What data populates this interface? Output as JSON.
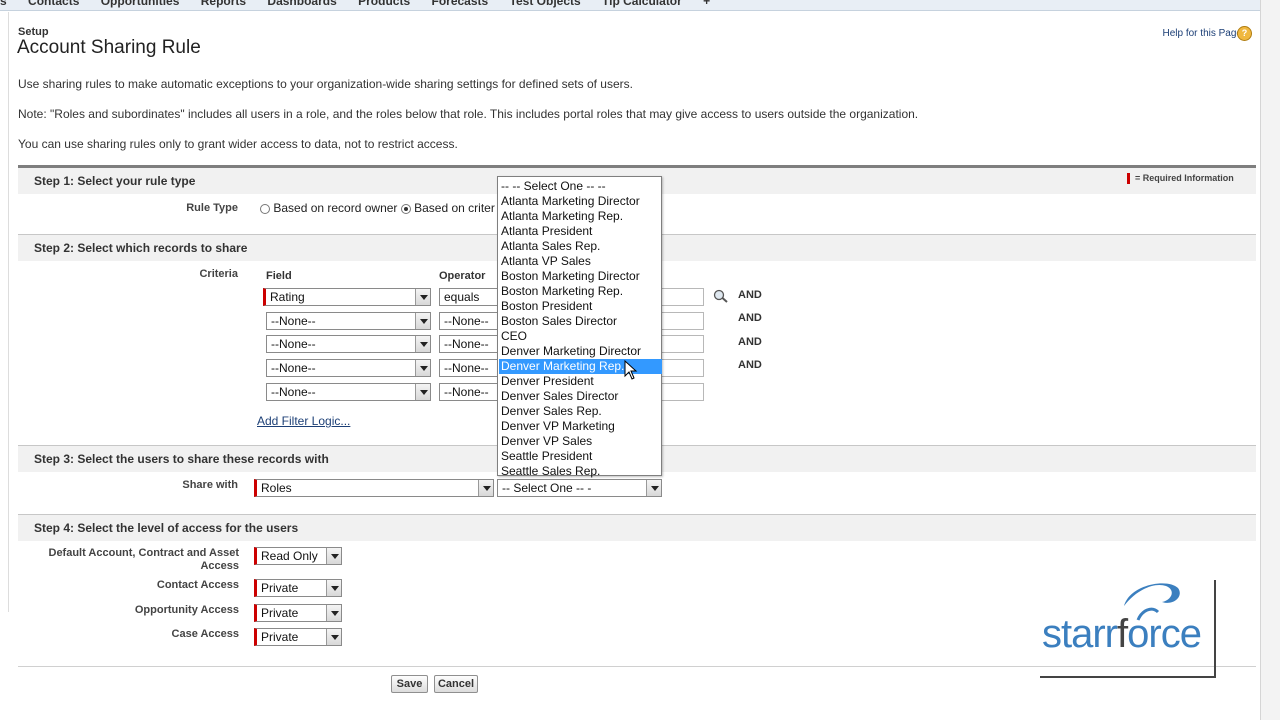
{
  "top_nav": {
    "tabs": [
      "s",
      "Contacts",
      "Opportunities",
      "Reports",
      "Dashboards",
      "Products",
      "Forecasts",
      "Test Objects",
      "Tip Calculator",
      "+"
    ]
  },
  "header": {
    "breadcrumb": "Setup",
    "title": "Account Sharing Rule",
    "help_link": "Help for this Page",
    "help_icon": "help-icon"
  },
  "intro": [
    "Use sharing rules to make automatic exceptions to your organization-wide sharing settings for defined sets of users.",
    "Note: \"Roles and subordinates\" includes all users in a role, and the roles below that role. This includes portal roles that may give access to users outside the organization.",
    "You can use sharing rules only to grant wider access to data, not to restrict access."
  ],
  "required_info": "= Required Information",
  "step1": {
    "title": "Step 1: Select your rule type",
    "rule_type_label": "Rule Type",
    "option_owner": "Based on record owner",
    "option_criteria": "Based on criter",
    "selected": "criteria"
  },
  "step2": {
    "title": "Step 2: Select which records to share",
    "criteria_label": "Criteria",
    "field_header": "Field",
    "operator_header": "Operator",
    "rows": [
      {
        "field": "Rating",
        "operator": "equals",
        "and": "AND"
      },
      {
        "field": "--None--",
        "operator": "--None--",
        "and": "AND"
      },
      {
        "field": "--None--",
        "operator": "--None--",
        "and": "AND"
      },
      {
        "field": "--None--",
        "operator": "--None--",
        "and": "AND"
      },
      {
        "field": "--None--",
        "operator": "--None--",
        "and": ""
      }
    ],
    "add_filter_logic": "Add Filter Logic..."
  },
  "step3": {
    "title": "Step 3: Select the users to share these records with",
    "share_with_label": "Share with",
    "share_with_value": "Roles",
    "role_select_value": "-- Select One -- -",
    "dropdown_options": [
      "-- -- Select One -- --",
      "Atlanta Marketing Director",
      "Atlanta Marketing Rep.",
      "Atlanta President",
      "Atlanta Sales Rep.",
      "Atlanta VP Sales",
      "Boston Marketing Director",
      "Boston Marketing Rep.",
      "Boston President",
      "Boston Sales Director",
      "CEO",
      "Denver Marketing Director",
      "Denver Marketing Rep.",
      "Denver President",
      "Denver Sales Director",
      "Denver Sales Rep.",
      "Denver VP Marketing",
      "Denver VP Sales",
      "Seattle President",
      "Seattle Sales Rep."
    ],
    "highlighted_option": "Denver Marketing Rep."
  },
  "step4": {
    "title": "Step 4: Select the level of access for the users",
    "rows": [
      {
        "label": "Default Account, Contract and Asset Access",
        "value": "Read Only"
      },
      {
        "label": "Contact Access",
        "value": "Private"
      },
      {
        "label": "Opportunity Access",
        "value": "Private"
      },
      {
        "label": "Case Access",
        "value": "Private"
      }
    ]
  },
  "buttons": {
    "save": "Save",
    "cancel": "Cancel"
  },
  "watermark": {
    "part1": "starr",
    "part2": "f",
    "part3": "orce"
  },
  "colors": {
    "required_bar": "#cc0000",
    "selection": "#3399ff",
    "logo_blue": "#3b7fbf",
    "link": "#1c3f76"
  }
}
